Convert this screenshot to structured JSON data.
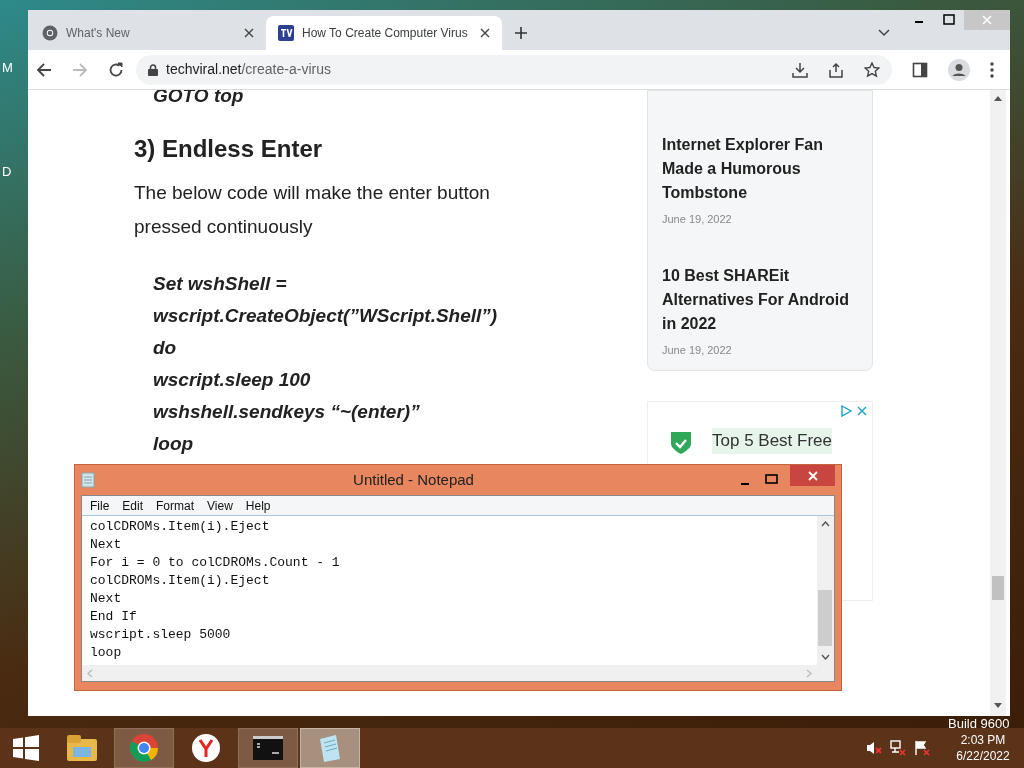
{
  "desktop": {
    "labels": [
      "M",
      "D"
    ],
    "watermark": "Build 9600"
  },
  "browser": {
    "tabs": [
      {
        "title": "What's New",
        "selected": false,
        "kind": "chrome"
      },
      {
        "title": "How To Create Computer Virus",
        "selected": true,
        "kind": "site"
      }
    ],
    "url": {
      "host": "techviral.net",
      "path": "/create-a-virus"
    },
    "article": {
      "code_top": [
        "GOTO top"
      ],
      "heading": "3) Endless Enter",
      "paragraph": "The below code will make the enter button pressed continuously",
      "code": [
        "Set wshShell =",
        "wscript.CreateObject(”WScript.Shell”)",
        "do",
        "wscript.sleep 100",
        "wshshell.sendkeys “~(enter)”",
        "loop"
      ]
    },
    "sidebar": {
      "posts": [
        {
          "title": "Internet Explorer Fan Made a Humorous Tombstone",
          "date": "June 19, 2022"
        },
        {
          "title": "10 Best SHAREit Alternatives For Android in 2022",
          "date": "June 19, 2022"
        }
      ],
      "ad": {
        "title": "Top 5 Best Free"
      }
    }
  },
  "notepad": {
    "title": "Untitled - Notepad",
    "menu": [
      "File",
      "Edit",
      "Format",
      "View",
      "Help"
    ],
    "lines": [
      "colCDROMs.Item(i).Eject",
      "Next",
      "For i = 0 to colCDROMs.Count - 1",
      "colCDROMs.Item(i).Eject",
      "Next",
      "End If",
      "wscript.sleep 5000",
      "loop"
    ]
  },
  "taskbar": {
    "apps": [
      {
        "kind": "explorer",
        "selected": false
      },
      {
        "kind": "chrome",
        "selected": true
      },
      {
        "kind": "yandex",
        "selected": false
      },
      {
        "kind": "cmd",
        "selected": true
      },
      {
        "kind": "notepad",
        "selected": true
      }
    ],
    "time": "2:03 PM",
    "date": "6/22/2022"
  }
}
